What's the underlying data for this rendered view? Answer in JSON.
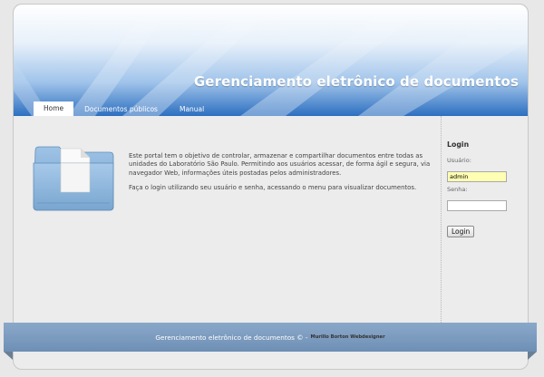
{
  "header": {
    "site_title": "Gerenciamento eletrônico de documentos",
    "nav": [
      {
        "label": "Home",
        "active": true
      },
      {
        "label": "Documentos públicos",
        "active": false
      },
      {
        "label": "Manual",
        "active": false
      }
    ]
  },
  "main": {
    "folder_icon": "folder-document-icon",
    "paragraph_1": "Este portal tem o objetivo de controlar, armazenar e compartilhar documentos entre todas as unidades do Laboratório São Paulo. Permitindo aos usuários acessar, de forma ágil e segura, via navegador Web, informações úteis postadas pelos administradores.",
    "paragraph_2": "Faça o login utilizando seu usuário e senha, acessando o menu para visualizar documentos."
  },
  "login": {
    "title": "Login",
    "user_label": "Usuário:",
    "user_value": "admin",
    "password_label": "Senha:",
    "password_value": "",
    "button_label": "Login"
  },
  "footer": {
    "text": "Gerenciamento eletrônico de documentos © - ",
    "credit": "Murillo Borton Webdesigner"
  },
  "colors": {
    "header_blue": "#2d6fc0",
    "footer_blue": "#7e9dc0",
    "input_highlight": "#ffffb3"
  }
}
